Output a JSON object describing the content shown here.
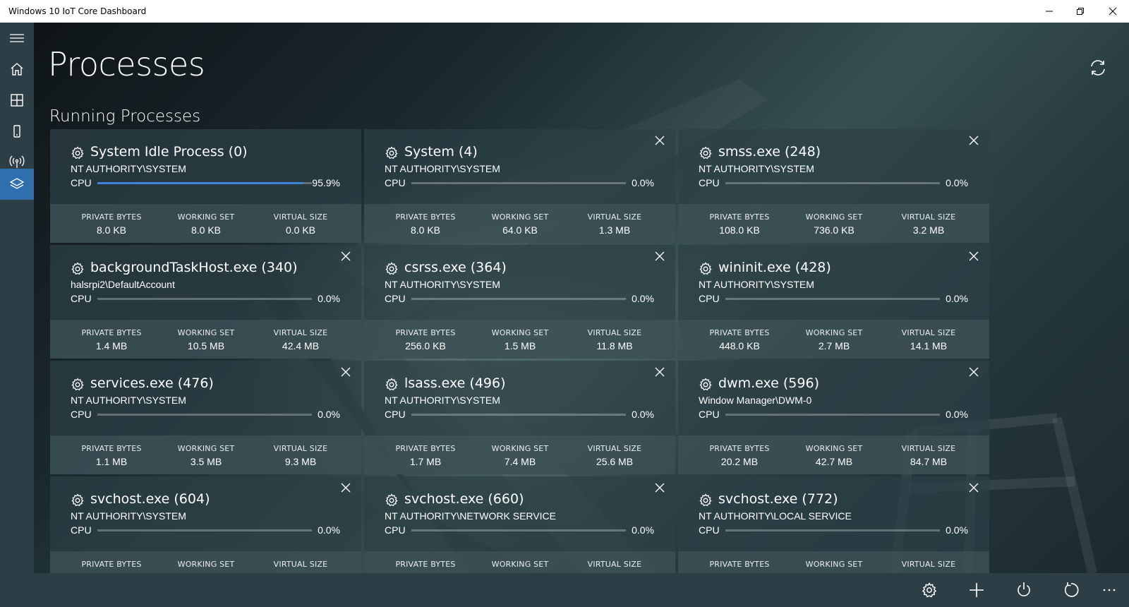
{
  "window": {
    "title": "Windows 10 IoT Core Dashboard"
  },
  "nav": {
    "items": [
      {
        "name": "menu-icon"
      },
      {
        "name": "home-icon"
      },
      {
        "name": "grid-icon"
      },
      {
        "name": "device-icon"
      },
      {
        "name": "antenna-icon"
      },
      {
        "name": "layers-icon",
        "active": true
      }
    ]
  },
  "page": {
    "title": "Processes",
    "section": "Running Processes"
  },
  "labels": {
    "cpu": "CPU",
    "private_bytes": "PRIVATE BYTES",
    "working_set": "WORKING SET",
    "virtual_size": "VIRTUAL SIZE"
  },
  "processes": [
    {
      "name": "System Idle Process (0)",
      "user": "NT AUTHORITY\\SYSTEM",
      "cpu": "95.9%",
      "cpu_fraction": 0.959,
      "private_bytes": "8.0 KB",
      "working_set": "8.0 KB",
      "virtual_size": "0.0 KB",
      "closable": false
    },
    {
      "name": "System (4)",
      "user": "NT AUTHORITY\\SYSTEM",
      "cpu": "0.0%",
      "cpu_fraction": 0,
      "private_bytes": "8.0 KB",
      "working_set": "64.0 KB",
      "virtual_size": "1.3 MB",
      "closable": true
    },
    {
      "name": "smss.exe (248)",
      "user": "NT AUTHORITY\\SYSTEM",
      "cpu": "0.0%",
      "cpu_fraction": 0,
      "private_bytes": "108.0 KB",
      "working_set": "736.0 KB",
      "virtual_size": "3.2 MB",
      "closable": true
    },
    {
      "name": "backgroundTaskHost.exe (340)",
      "user": "halsrpi2\\DefaultAccount",
      "cpu": "0.0%",
      "cpu_fraction": 0,
      "private_bytes": "1.4 MB",
      "working_set": "10.5 MB",
      "virtual_size": "42.4 MB",
      "closable": true
    },
    {
      "name": "csrss.exe (364)",
      "user": "NT AUTHORITY\\SYSTEM",
      "cpu": "0.0%",
      "cpu_fraction": 0,
      "private_bytes": "256.0 KB",
      "working_set": "1.5 MB",
      "virtual_size": "11.8 MB",
      "closable": true
    },
    {
      "name": "wininit.exe (428)",
      "user": "NT AUTHORITY\\SYSTEM",
      "cpu": "0.0%",
      "cpu_fraction": 0,
      "private_bytes": "448.0 KB",
      "working_set": "2.7 MB",
      "virtual_size": "14.1 MB",
      "closable": true
    },
    {
      "name": "services.exe (476)",
      "user": "NT AUTHORITY\\SYSTEM",
      "cpu": "0.0%",
      "cpu_fraction": 0,
      "private_bytes": "1.1 MB",
      "working_set": "3.5 MB",
      "virtual_size": "9.3 MB",
      "closable": true
    },
    {
      "name": "lsass.exe (496)",
      "user": "NT AUTHORITY\\SYSTEM",
      "cpu": "0.0%",
      "cpu_fraction": 0,
      "private_bytes": "1.7 MB",
      "working_set": "7.4 MB",
      "virtual_size": "25.6 MB",
      "closable": true
    },
    {
      "name": "dwm.exe (596)",
      "user": "Window Manager\\DWM-0",
      "cpu": "0.0%",
      "cpu_fraction": 0,
      "private_bytes": "20.2 MB",
      "working_set": "42.7 MB",
      "virtual_size": "84.7 MB",
      "closable": true
    },
    {
      "name": "svchost.exe (604)",
      "user": "NT AUTHORITY\\SYSTEM",
      "cpu": "0.0%",
      "cpu_fraction": 0,
      "private_bytes": "",
      "working_set": "",
      "virtual_size": "",
      "closable": true
    },
    {
      "name": "svchost.exe (660)",
      "user": "NT AUTHORITY\\NETWORK SERVICE",
      "cpu": "0.0%",
      "cpu_fraction": 0,
      "private_bytes": "",
      "working_set": "",
      "virtual_size": "",
      "closable": true
    },
    {
      "name": "svchost.exe (772)",
      "user": "NT AUTHORITY\\LOCAL SERVICE",
      "cpu": "0.0%",
      "cpu_fraction": 0,
      "private_bytes": "",
      "working_set": "",
      "virtual_size": "",
      "closable": true
    }
  ],
  "cmdbar": {
    "items": [
      {
        "name": "settings-icon"
      },
      {
        "name": "add-icon"
      },
      {
        "name": "power-icon"
      },
      {
        "name": "restart-icon"
      },
      {
        "name": "more-icon"
      }
    ]
  },
  "colors": {
    "accent": "#2f6fae",
    "cpu_bar": "#3d84d4",
    "rail": "#2e3e46"
  }
}
